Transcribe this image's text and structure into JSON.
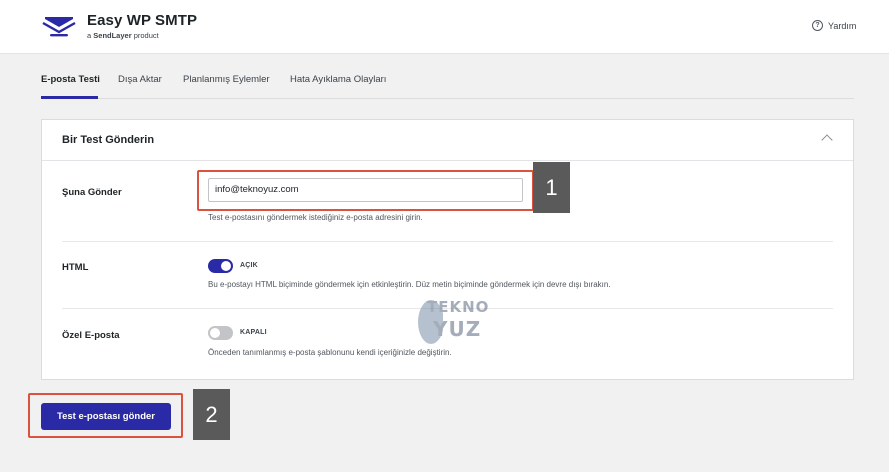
{
  "header": {
    "brand": "Easy WP SMTP",
    "brand_sub_prefix": "a ",
    "brand_sub_bold": "SendLayer",
    "brand_sub_suffix": " product",
    "help_label": "Yardım",
    "logo_icon": "envelope-logo-icon",
    "help_icon": "question-circle-icon"
  },
  "tabs": [
    {
      "label": "E-posta Testi",
      "active": true
    },
    {
      "label": "Dışa Aktar",
      "active": false
    },
    {
      "label": "Planlanmış Eylemler",
      "active": false
    },
    {
      "label": "Hata Ayıklama Olayları",
      "active": false
    }
  ],
  "card": {
    "title": "Bir Test Gönderin",
    "collapse_icon": "chevron-up-icon",
    "send_to": {
      "label": "Şuna Gönder",
      "value": "info@teknoyuz.com",
      "help": "Test e-postasını göndermek istediğiniz e-posta adresini girin."
    },
    "html": {
      "label": "HTML",
      "state": "AÇIK",
      "on": true,
      "help": "Bu e-postayı HTML biçiminde göndermek için etkinleştirin. Düz metin biçiminde göndermek için devre dışı bırakın."
    },
    "custom_email": {
      "label": "Özel E-posta",
      "state": "KAPALI",
      "on": false,
      "help": "Önceden tanımlanmış e-posta şablonunu kendi içeriğinizle değiştirin."
    }
  },
  "send_button": "Test e-postası gönder",
  "annotations": {
    "callout_1": "1",
    "callout_2": "2"
  },
  "watermark": {
    "line1": "TEKNO",
    "line2": "YUZ"
  },
  "colors": {
    "accent": "#2b2aa6",
    "highlight": "#d9533f",
    "callout_bg": "#5a5a5a"
  }
}
